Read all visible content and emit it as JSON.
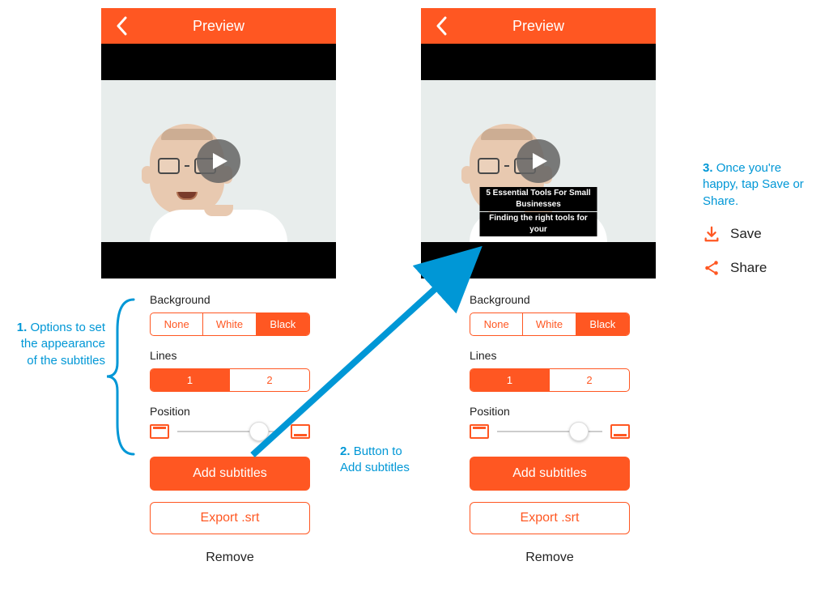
{
  "nav": {
    "title": "Preview"
  },
  "subtitles": {
    "line1": "5 Essential Tools For Small Businesses",
    "line2": "Finding the right tools for your"
  },
  "controls": {
    "background": {
      "label": "Background",
      "options": [
        "None",
        "White",
        "Black"
      ],
      "active": 2
    },
    "lines": {
      "label": "Lines",
      "options": [
        "1",
        "2"
      ],
      "active": 0
    },
    "position": {
      "label": "Position",
      "value": 0.78
    },
    "add_btn": "Add subtitles",
    "export_btn": "Export .srt",
    "remove_btn": "Remove"
  },
  "annotations": {
    "a1_num": "1.",
    "a1_text": "Options to set the appearance of the subtitles",
    "a2_num": "2.",
    "a2_text": "Button to Add subtitles",
    "a3_num": "3.",
    "a3_text": "Once you're happy, tap Save or Share."
  },
  "actions": {
    "save": "Save",
    "share": "Share"
  }
}
